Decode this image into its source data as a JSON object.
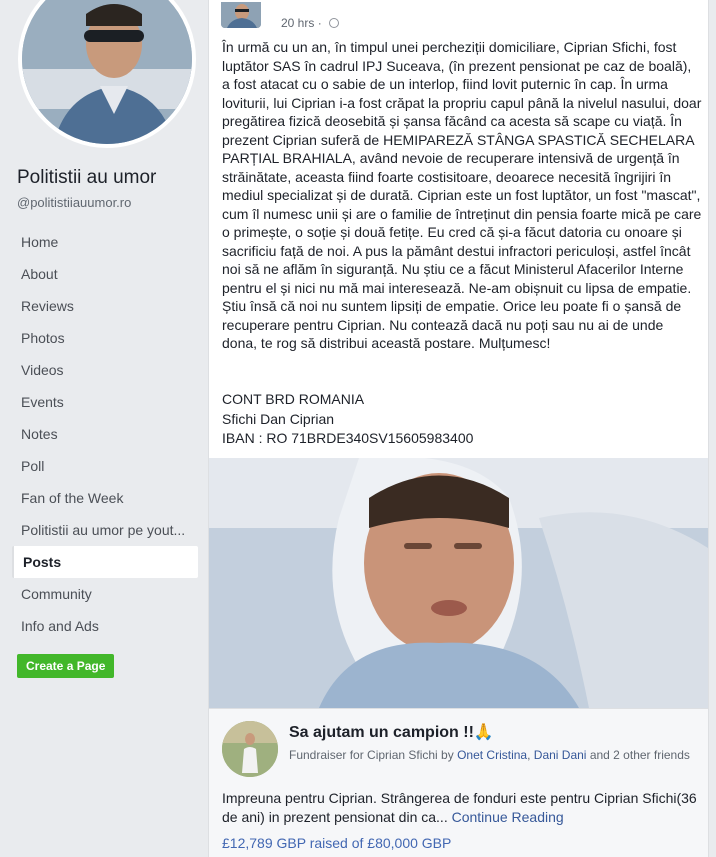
{
  "page": {
    "name": "Politistii au umor",
    "handle": "@politistiiauumor.ro"
  },
  "sidebar": {
    "items": [
      {
        "label": "Home"
      },
      {
        "label": "About"
      },
      {
        "label": "Reviews"
      },
      {
        "label": "Photos"
      },
      {
        "label": "Videos"
      },
      {
        "label": "Events"
      },
      {
        "label": "Notes"
      },
      {
        "label": "Poll"
      },
      {
        "label": "Fan of the Week"
      },
      {
        "label": "Politistii au umor pe yout..."
      },
      {
        "label": "Posts"
      },
      {
        "label": "Community"
      },
      {
        "label": "Info and Ads"
      }
    ],
    "active_index": 10,
    "create_page_label": "Create a Page"
  },
  "post": {
    "timestamp": "20 hrs",
    "privacy_icon": "globe-icon",
    "text": "În urmă cu un an, în timpul unei percheziții domiciliare, Ciprian Sfichi, fost luptător SAS în cadrul IPJ Suceava, (în prezent pensionat pe caz de boală), a fost atacat cu o sabie de un interlop, fiind lovit puternic în cap. În urma loviturii, lui Ciprian i-a fost crăpat la propriu capul până la nivelul nasului, doar pregătirea fizică deosebită și șansa făcând ca acesta să scape cu viață. În prezent Ciprian suferă de HEMIPAREZĂ STÂNGA SPASTICĂ SECHELARA PARȚIAL BRAHIALA, având nevoie de recuperare intensivă de urgență în străinătate, aceasta fiind foarte costisitoare, deoarece necesită îngrijiri în mediul specializat și de durată. Ciprian este un fost luptător, un fost \"mascat\", cum îl numesc unii și are o familie de întreținut din pensia foarte mică pe care o primește, o soție și două fetițe. Eu cred că și-a făcut datoria cu onoare și sacrificiu față de noi. A pus la pământ destui infractori periculoși, astfel încât noi să ne aflăm în siguranță. Nu știu ce a făcut Ministerul Afacerilor Interne pentru el și nici nu mă mai interesează. Ne-am obișnuit cu lipsa de empatie. Știu însă că noi nu suntem lipsiți de empatie. Orice leu poate fi o șansă de recuperare pentru Ciprian. Nu contează dacă nu poți sau nu ai de unde dona, te rog să distribui această postare. Mulțumesc!",
    "bank_line1": "CONT BRD ROMANIA",
    "bank_line2": "Sfichi Dan Ciprian",
    "bank_line3": "IBAN : RO 71BRDE340SV15605983400"
  },
  "fundraiser": {
    "title": "Sa ajutam un campion !!🙏",
    "sub_prefix": "Fundraiser for Ciprian Sfichi by ",
    "organizer1": "Onet Cristina",
    "sep": ", ",
    "organizer2": "Dani Dani",
    "sub_suffix": " and 2 other friends",
    "description": "Impreuna pentru Ciprian. Strângerea de fonduri este pentru Ciprian Sfichi(36 de ani) in prezent pensionat din ca...",
    "continue_label": "Continue Reading",
    "raised": "£12,789 GBP raised of £80,000 GBP"
  }
}
